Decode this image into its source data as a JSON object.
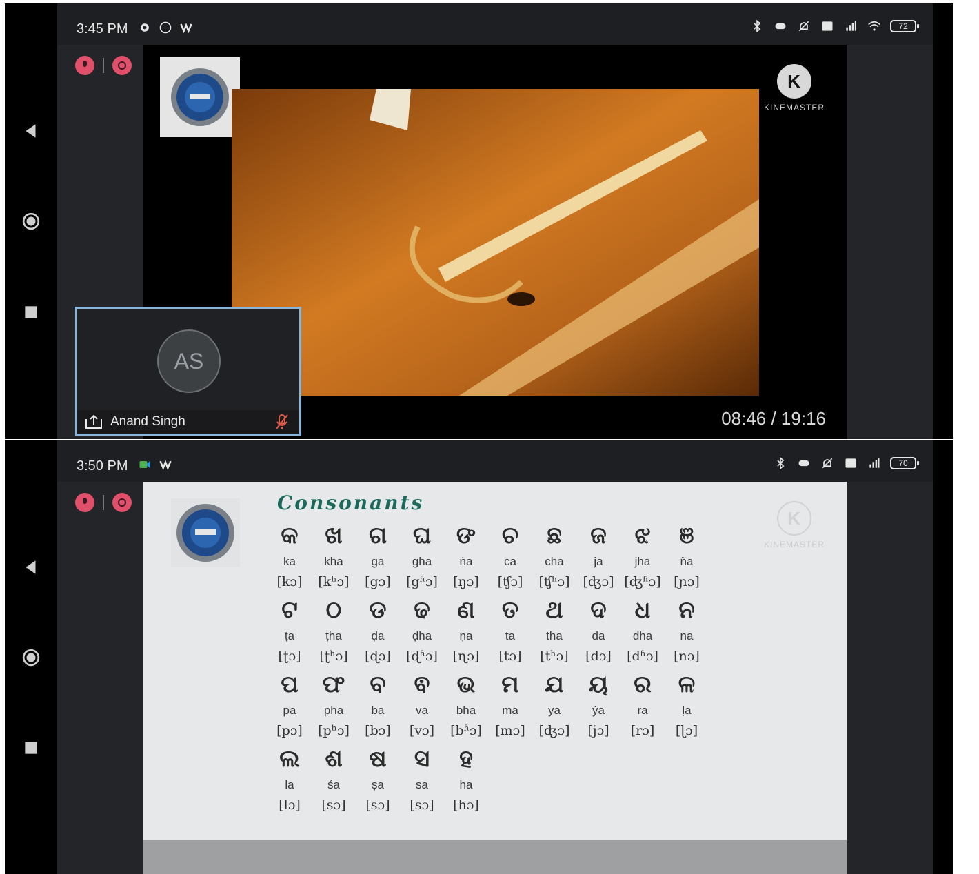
{
  "top_screen": {
    "status": {
      "time": "3:45 PM",
      "battery": "72"
    },
    "video": {
      "timer": "08:46 / 19:16",
      "watermark": "KINEMASTER",
      "watermark_logo": "K"
    },
    "participant": {
      "initials": "AS",
      "name": "Anand Singh"
    }
  },
  "bottom_screen": {
    "status": {
      "time": "3:50 PM",
      "battery": "70"
    },
    "slide": {
      "title": "Consonants",
      "watermark": "KINEMASTER",
      "watermark_logo": "K",
      "rows": [
        [
          {
            "g": "କ",
            "r": "ka",
            "i": "[kɔ]"
          },
          {
            "g": "ଖ",
            "r": "kha",
            "i": "[kʰɔ]"
          },
          {
            "g": "ଗ",
            "r": "ga",
            "i": "[gɔ]"
          },
          {
            "g": "ଘ",
            "r": "gha",
            "i": "[gʱɔ]"
          },
          {
            "g": "ଙ",
            "r": "ṅa",
            "i": "[ŋɔ]"
          },
          {
            "g": "ଚ",
            "r": "ca",
            "i": "[ʧɔ]"
          },
          {
            "g": "ଛ",
            "r": "cha",
            "i": "[ʧʰɔ]"
          },
          {
            "g": "ଜ",
            "r": "ja",
            "i": "[ʤɔ]"
          },
          {
            "g": "ଝ",
            "r": "jha",
            "i": "[ʤʱɔ]"
          },
          {
            "g": "ଞ",
            "r": "ña",
            "i": "[ɲɔ]"
          }
        ],
        [
          {
            "g": "ଟ",
            "r": "ṭa",
            "i": "[ʈɔ]"
          },
          {
            "g": "ଠ",
            "r": "ṭha",
            "i": "[ʈʰɔ]"
          },
          {
            "g": "ଡ",
            "r": "ḍa",
            "i": "[ɖɔ]"
          },
          {
            "g": "ଢ",
            "r": "ḍha",
            "i": "[ɖʱɔ]"
          },
          {
            "g": "ଣ",
            "r": "ṇa",
            "i": "[ɳɔ]"
          },
          {
            "g": "ତ",
            "r": "ta",
            "i": "[tɔ]"
          },
          {
            "g": "ଥ",
            "r": "tha",
            "i": "[tʰɔ]"
          },
          {
            "g": "ଦ",
            "r": "da",
            "i": "[dɔ]"
          },
          {
            "g": "ଧ",
            "r": "dha",
            "i": "[dʱɔ]"
          },
          {
            "g": "ନ",
            "r": "na",
            "i": "[nɔ]"
          }
        ],
        [
          {
            "g": "ପ",
            "r": "pa",
            "i": "[pɔ]"
          },
          {
            "g": "ଫ",
            "r": "pha",
            "i": "[pʰɔ]"
          },
          {
            "g": "ବ",
            "r": "ba",
            "i": "[bɔ]"
          },
          {
            "g": "ଵ",
            "r": "va",
            "i": "[vɔ]"
          },
          {
            "g": "ଭ",
            "r": "bha",
            "i": "[bʱɔ]"
          },
          {
            "g": "ମ",
            "r": "ma",
            "i": "[mɔ]"
          },
          {
            "g": "ଯ",
            "r": "ya",
            "i": "[ʤɔ]"
          },
          {
            "g": "ୟ",
            "r": "ẏa",
            "i": "[jɔ]"
          },
          {
            "g": "ର",
            "r": "ra",
            "i": "[rɔ]"
          },
          {
            "g": "ଳ",
            "r": "ḷa",
            "i": "[ɭɔ]"
          }
        ],
        [
          {
            "g": "ଲ",
            "r": "la",
            "i": "[lɔ]"
          },
          {
            "g": "ଶ",
            "r": "śa",
            "i": "[sɔ]"
          },
          {
            "g": "ଷ",
            "r": "ṣa",
            "i": "[sɔ]"
          },
          {
            "g": "ସ",
            "r": "sa",
            "i": "[sɔ]"
          },
          {
            "g": "ହ",
            "r": "ha",
            "i": "[hɔ]"
          }
        ]
      ]
    }
  }
}
